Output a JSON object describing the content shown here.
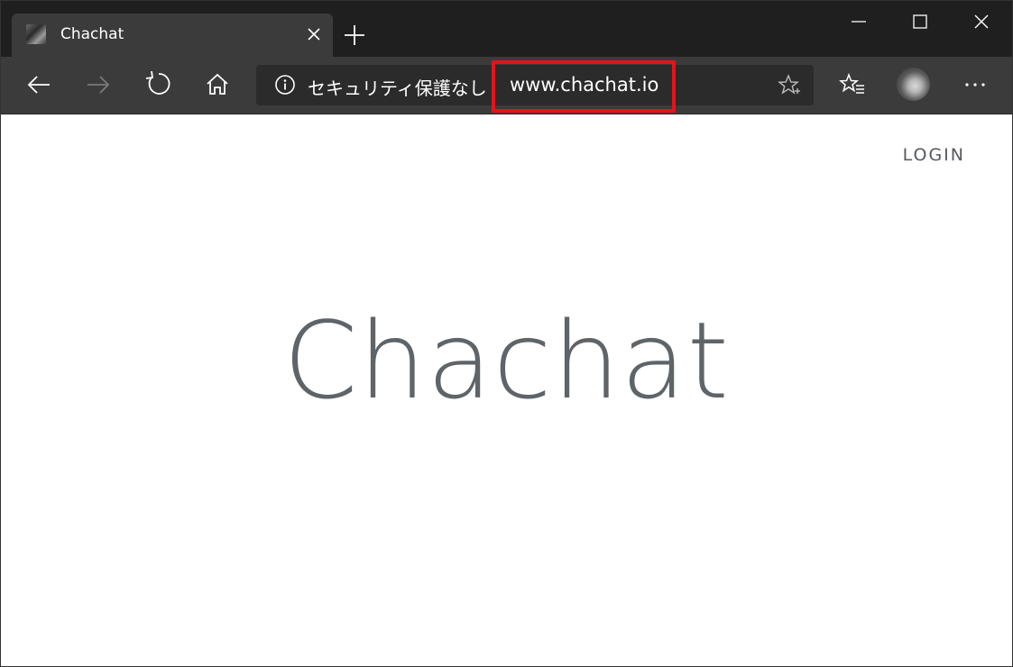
{
  "browser": {
    "tab": {
      "title": "Chachat",
      "favicon": "cat-photo-favicon"
    },
    "toolbar": {
      "back_icon": "arrow-left-icon",
      "forward_icon": "arrow-right-icon",
      "refresh_icon": "refresh-icon",
      "home_icon": "home-icon",
      "favorites_icon": "favorites-list-icon",
      "more_icon": "more-ellipsis-icon"
    },
    "address_bar": {
      "security_text": "セキュリティ保護なし",
      "url": "www.chachat.io"
    },
    "colors": {
      "titlebar_bg": "#1f1f1f",
      "toolbar_bg": "#3b3b3b",
      "highlight_border": "#e3141b"
    }
  },
  "page": {
    "login_label": "LOGIN",
    "hero_title": "Chachat",
    "colors": {
      "background": "#ffffff",
      "title": "#5f6468"
    }
  }
}
